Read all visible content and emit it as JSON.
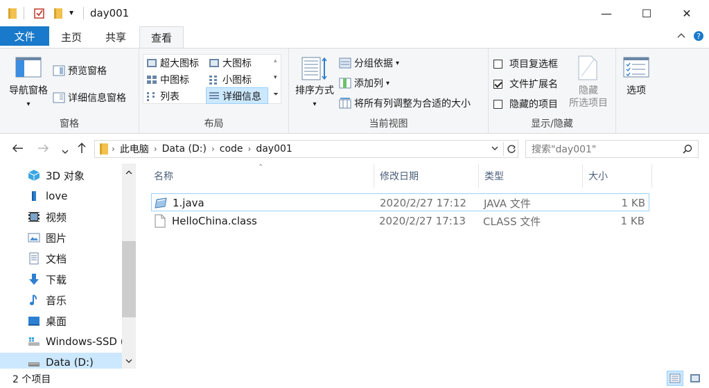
{
  "window": {
    "title": "day001",
    "quick_access_dropdown": "▾",
    "minimize": "—",
    "maximize": "☐",
    "close": "✕"
  },
  "tabs": [
    {
      "label": "文件"
    },
    {
      "label": "主页"
    },
    {
      "label": "共享"
    },
    {
      "label": "查看"
    }
  ],
  "ribbon": {
    "pane": {
      "nav_pane": "导航窗格",
      "preview_pane": "预览窗格",
      "details_pane": "详细信息窗格",
      "label": "窗格"
    },
    "layout": {
      "items": [
        "超大图标",
        "大图标",
        "中图标",
        "小图标",
        "列表",
        "详细信息"
      ],
      "selected": "详细信息",
      "label": "布局"
    },
    "current_view": {
      "sort_by": "排序方式",
      "group_by": "分组依据",
      "add_columns": "添加列",
      "fit_columns": "将所有列调整为合适的大小",
      "label": "当前视图"
    },
    "show_hide": {
      "item_checkboxes": {
        "label": "项目复选框",
        "checked": false
      },
      "file_extensions": {
        "label": "文件扩展名",
        "checked": true
      },
      "hidden_items": {
        "label": "隐藏的项目",
        "checked": false
      },
      "hide_selected_1": "隐藏",
      "hide_selected_2": "所选项目",
      "label": "显示/隐藏"
    },
    "options": "选项"
  },
  "address": {
    "crumbs": [
      "此电脑",
      "Data (D:)",
      "code",
      "day001"
    ],
    "search_placeholder": "搜索\"day001\""
  },
  "nav_pane": {
    "items": [
      "3D 对象",
      "love",
      "视频",
      "图片",
      "文档",
      "下载",
      "音乐",
      "桌面",
      "Windows-SSD (",
      "Data (D:)"
    ],
    "selected": "Data (D:)"
  },
  "file_list": {
    "columns": [
      "名称",
      "修改日期",
      "类型",
      "大小"
    ],
    "rows": [
      {
        "name": "1.java",
        "modified": "2020/2/27 17:12",
        "type": "JAVA 文件",
        "size": "1 KB"
      },
      {
        "name": "HelloChina.class",
        "modified": "2020/2/27 17:13",
        "type": "CLASS 文件",
        "size": "1 KB"
      }
    ]
  },
  "status": {
    "item_count": "2 个项目"
  },
  "colors": {
    "accent": "#1979ca",
    "selection": "#cce8ff",
    "selection_border": "#99d1ff"
  }
}
